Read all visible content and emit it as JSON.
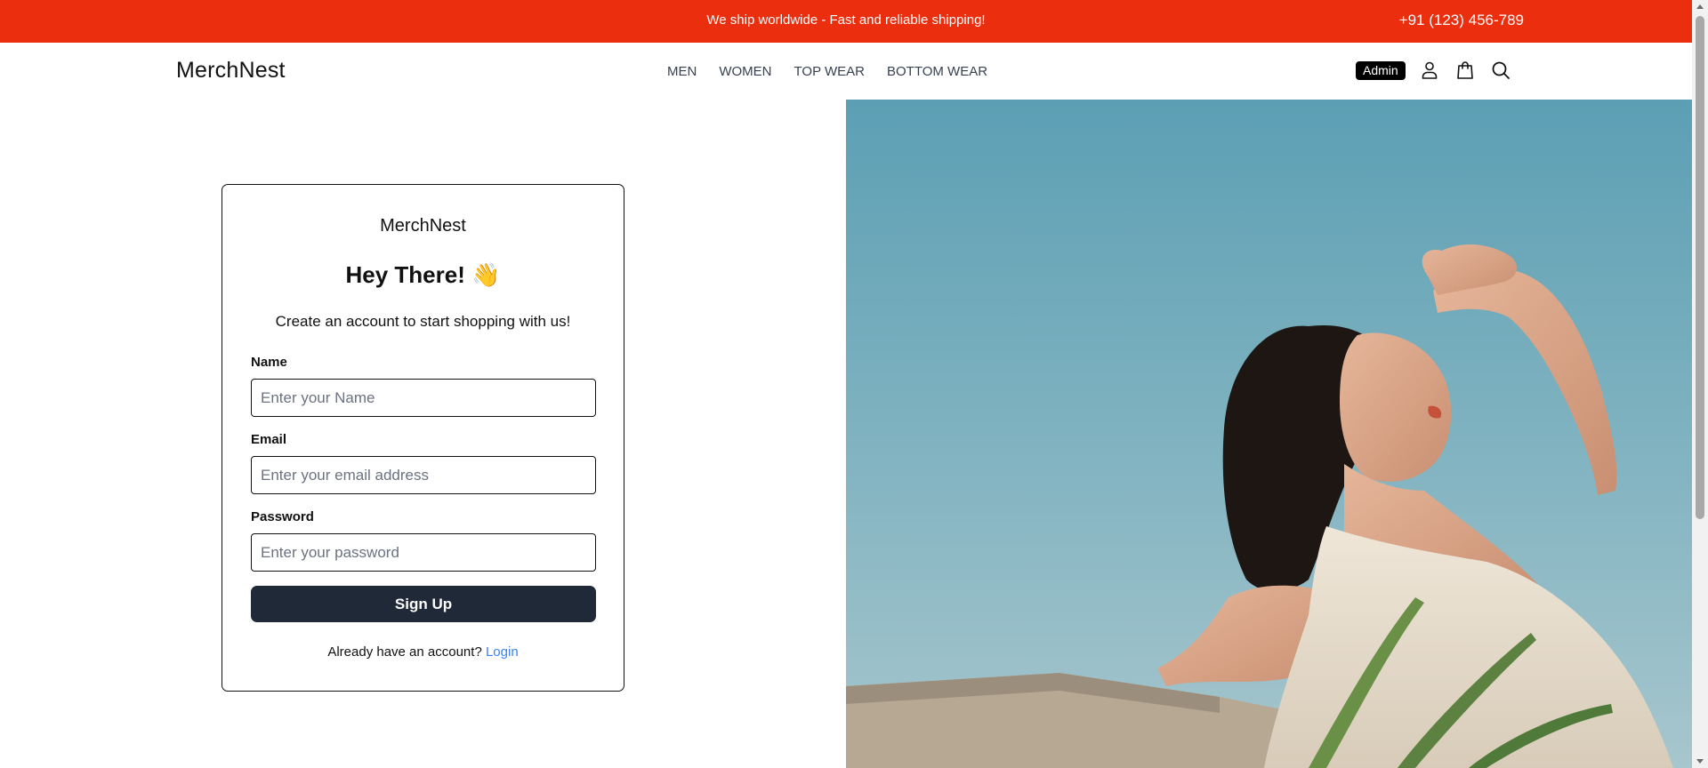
{
  "topbar": {
    "message": "We ship worldwide - Fast and reliable shipping!",
    "phone": "+91 (123) 456-789",
    "color": "#ea2e0e"
  },
  "navbar": {
    "logo": "MerchNest",
    "links": [
      "MEN",
      "WOMEN",
      "TOP WEAR",
      "BOTTOM WEAR"
    ],
    "admin_badge": "Admin",
    "icons": [
      "user-icon",
      "shopping-bag-icon",
      "search-icon"
    ]
  },
  "signup": {
    "brand": "MerchNest",
    "title": "Hey There! 👋",
    "subtitle": "Create an account to start shopping with us!",
    "fields": [
      {
        "label": "Name",
        "placeholder": "Enter your Name",
        "value": ""
      },
      {
        "label": "Email",
        "placeholder": "Enter your email address",
        "value": ""
      },
      {
        "label": "Password",
        "placeholder": "Enter your password",
        "value": ""
      }
    ],
    "submit_label": "Sign Up",
    "login_prompt": "Already have an account?",
    "login_link": "Login",
    "button_color": "#1f2937",
    "link_color": "#3b82f6"
  }
}
